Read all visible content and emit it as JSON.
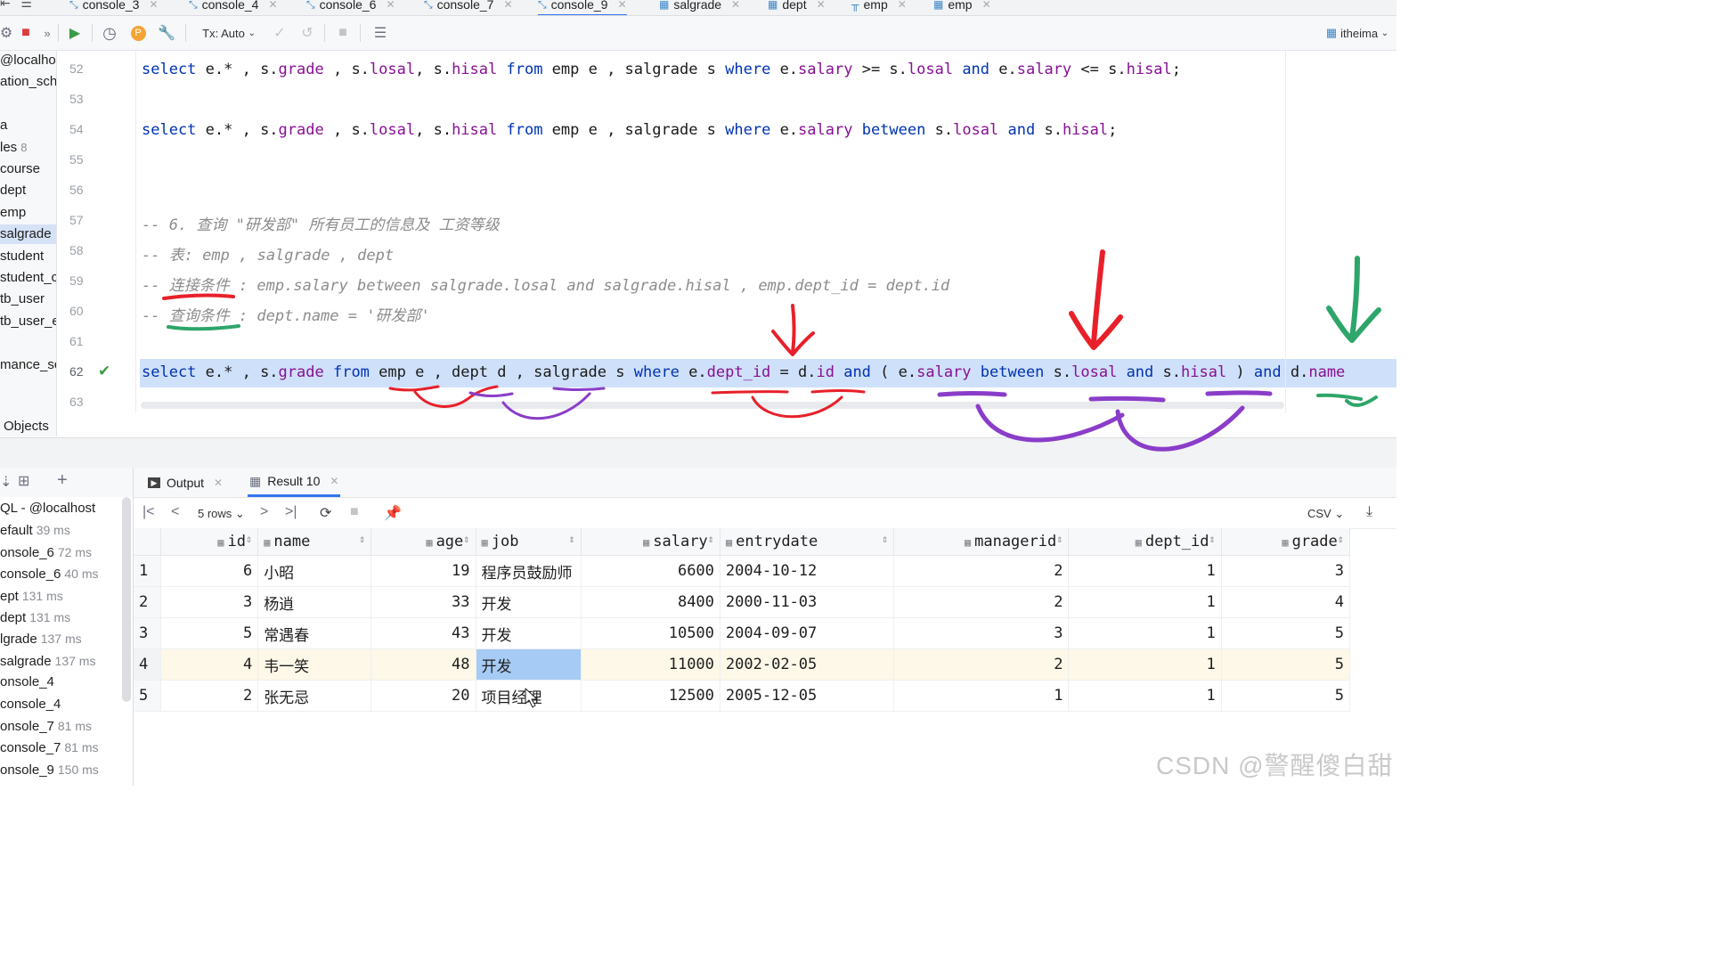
{
  "tabs": [
    {
      "label": "console_3"
    },
    {
      "label": "console_4"
    },
    {
      "label": "console_6"
    },
    {
      "label": "console_7"
    },
    {
      "label": "console_9"
    },
    {
      "label": "salgrade"
    },
    {
      "label": "dept"
    },
    {
      "label": "emp"
    },
    {
      "label": "emp"
    }
  ],
  "toolbar": {
    "tx_mode": "Tx: Auto",
    "datasource": "itheima"
  },
  "db_tree": [
    {
      "label": "@localho"
    },
    {
      "label": "ation_sch"
    },
    {
      "label": ""
    },
    {
      "label": "a"
    },
    {
      "label": "les",
      "count": "8"
    },
    {
      "label": "course"
    },
    {
      "label": "dept"
    },
    {
      "label": "emp"
    },
    {
      "label": "salgrade"
    },
    {
      "label": "student"
    },
    {
      "label": "student_c"
    },
    {
      "label": "tb_user"
    },
    {
      "label": "tb_user_e"
    },
    {
      "label": ""
    },
    {
      "label": "mance_sc"
    }
  ],
  "objects_label": "Objects",
  "editor": {
    "line_numbers": [
      "52",
      "53",
      "54",
      "55",
      "56",
      "57",
      "58",
      "59",
      "60",
      "61",
      "62",
      "63"
    ],
    "line52": {
      "a": "select",
      "b": " e.* , s.",
      "c": "grade",
      "d": " , s.",
      "e": "losal",
      "f": ", s.",
      "g": "hisal",
      "h": " from",
      "i": " emp e , salgrade s ",
      "j": "where",
      "k": " e.",
      "l": "salary",
      "m": " >= s.",
      "n": "losal",
      "o": " and",
      "p": " e.",
      "q": "salary",
      "r": " <= s.",
      "s": "hisal",
      "t": ";"
    },
    "line54": {
      "a": "select",
      "b": " e.* , s.",
      "c": "grade",
      "d": " , s.",
      "e": "losal",
      "f": ", s.",
      "g": "hisal",
      "h": " from",
      "i": " emp e , salgrade s ",
      "j": "where",
      "k": " e.",
      "l": "salary",
      "m": " between",
      "n": " s.",
      "o": "losal",
      "p": " and",
      "q": " s.",
      "r": "hisal",
      "s": ";"
    },
    "line57": "-- 6. 查询 \"研发部\" 所有员工的信息及 工资等级",
    "line58": "-- 表: emp , salgrade , dept",
    "line59": "-- 连接条件 : emp.salary between salgrade.losal and salgrade.hisal , emp.dept_id = dept.id",
    "line60": "-- 查询条件 : dept.name = '研发部'",
    "line62": {
      "a": "select",
      "b": " e.* , s.",
      "c": "grade",
      "d": " from",
      "e": " emp e , dept d , salgrade s ",
      "f": "where",
      "g": " e.",
      "h": "dept_id",
      "i": " = d.",
      "j": "id",
      "k": " and",
      "l": " ( e.",
      "m": "salary",
      "n": " between",
      "o": " s.",
      "p": "losal",
      "q": " and",
      "r": " s.",
      "s": "hisal",
      "t": " ) ",
      "u": "and",
      "v": " d.",
      "w": "name"
    }
  },
  "services": [
    {
      "label": "QL - @localhost",
      "ms": ""
    },
    {
      "label": "efault",
      "ms": "39 ms"
    },
    {
      "label": "onsole_6",
      "ms": "72 ms"
    },
    {
      "label": "console_6",
      "ms": "40 ms"
    },
    {
      "label": "ept",
      "ms": "131 ms"
    },
    {
      "label": "dept",
      "ms": "131 ms"
    },
    {
      "label": "lgrade",
      "ms": "137 ms"
    },
    {
      "label": "salgrade",
      "ms": "137 ms"
    },
    {
      "label": "onsole_4",
      "ms": ""
    },
    {
      "label": "console_4",
      "ms": ""
    },
    {
      "label": "onsole_7",
      "ms": "81 ms"
    },
    {
      "label": "console_7",
      "ms": "81 ms"
    },
    {
      "label": "onsole_9",
      "ms": "150 ms"
    }
  ],
  "result_tabs": {
    "output": "Output",
    "result": "Result 10"
  },
  "result_toolbar": {
    "rows": "5 rows",
    "export": "CSV"
  },
  "grid": {
    "columns": [
      "id",
      "name",
      "age",
      "job",
      "salary",
      "entrydate",
      "managerid",
      "dept_id",
      "grade"
    ],
    "rows": [
      {
        "rn": "1",
        "id": "6",
        "name": "小昭",
        "age": "19",
        "job": "程序员鼓励师",
        "salary": "6600",
        "entrydate": "2004-10-12",
        "managerid": "2",
        "dept_id": "1",
        "grade": "3"
      },
      {
        "rn": "2",
        "id": "3",
        "name": "杨逍",
        "age": "33",
        "job": "开发",
        "salary": "8400",
        "entrydate": "2000-11-03",
        "managerid": "2",
        "dept_id": "1",
        "grade": "4"
      },
      {
        "rn": "3",
        "id": "5",
        "name": "常遇春",
        "age": "43",
        "job": "开发",
        "salary": "10500",
        "entrydate": "2004-09-07",
        "managerid": "3",
        "dept_id": "1",
        "grade": "5"
      },
      {
        "rn": "4",
        "id": "4",
        "name": "韦一笑",
        "age": "48",
        "job": "开发",
        "salary": "11000",
        "entrydate": "2002-02-05",
        "managerid": "2",
        "dept_id": "1",
        "grade": "5"
      },
      {
        "rn": "5",
        "id": "2",
        "name": "张无忌",
        "age": "20",
        "job": "项目经理",
        "salary": "12500",
        "entrydate": "2005-12-05",
        "managerid": "1",
        "dept_id": "1",
        "grade": "5"
      }
    ]
  },
  "watermark": "CSDN @警醒傻白甜",
  "colors": {
    "accent": "#3574f0",
    "keyword": "#0033b3",
    "field": "#871094",
    "selected_line": "#cfe0fa",
    "ink_red": "#e8202a",
    "ink_green": "#2ea56a",
    "ink_purple": "#8a3dc9"
  }
}
